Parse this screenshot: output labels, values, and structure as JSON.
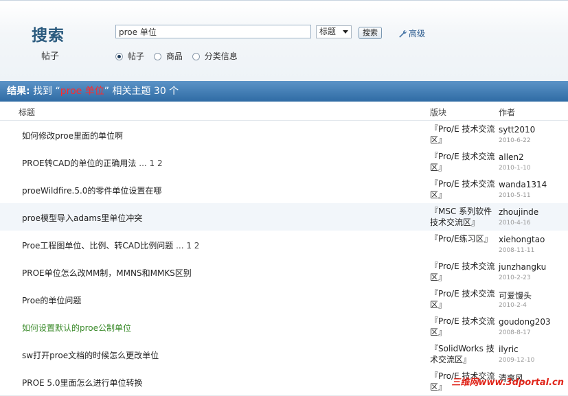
{
  "search": {
    "title": "搜索",
    "subtitle": "帖子",
    "query": "proe 单位",
    "scope_selected": "标题",
    "submit_label": "搜索",
    "advanced_label": "高级",
    "types": [
      "帖子",
      "商品",
      "分类信息"
    ],
    "type_selected": "帖子"
  },
  "results": {
    "prefix": "结果:",
    "found": "找到",
    "keyword_open": "“",
    "keyword": "proe 单位",
    "keyword_close": "”",
    "suffix": "相关主题",
    "count": "30 个"
  },
  "table": {
    "headers": {
      "title": "标题",
      "forum": "版块",
      "author": "作者"
    },
    "rows": [
      {
        "title": "如何修改proe里面的单位啊",
        "pages": "",
        "forum": "『Pro/E 技术交流区』",
        "author": "sytt2010",
        "date": "2010-6-22"
      },
      {
        "title": "PROE转CAD的单位的正确用法",
        "pages": "... 1 2",
        "forum": "『Pro/E 技术交流区』",
        "author": "allen2",
        "date": "2010-1-10"
      },
      {
        "title": "proeWildfire.5.0的零件单位设置在哪",
        "pages": "",
        "forum": "『Pro/E 技术交流区』",
        "author": "wanda1314",
        "date": "2010-5-11"
      },
      {
        "title": "proe模型导入adams里单位冲突",
        "pages": "",
        "forum": "『MSC 系列软件技术交流区』",
        "author": "zhoujinde",
        "date": "2010-4-16"
      },
      {
        "title": "Proe工程图单位、比例、转CAD比例问题",
        "pages": "... 1 2",
        "forum": "『Pro/E练习区』",
        "author": "xiehongtao",
        "date": "2008-11-11"
      },
      {
        "title": "PROE单位怎么改MM制，MMNS和MMKS区别",
        "pages": "",
        "forum": "『Pro/E 技术交流区』",
        "author": "junzhangku",
        "date": "2010-2-23"
      },
      {
        "title": "Proe的单位问题",
        "pages": "",
        "forum": "『Pro/E 技术交流区』",
        "author": "可爱馒头",
        "date": "2010-2-4"
      },
      {
        "title": "如何设置默认的proe公制单位",
        "pages": "",
        "forum": "『Pro/E 技术交流区』",
        "author": "goudong203",
        "date": "2008-8-17"
      },
      {
        "title": "sw打开proe文档的时候怎么更改单位",
        "pages": "",
        "forum": "『SolidWorks 技术交流区』",
        "author": "ilyric",
        "date": "2009-12-10"
      },
      {
        "title": "PROE 5.0里面怎么进行单位转换",
        "pages": "",
        "forum": "『Pro/E 技术交流区』",
        "author": "清爽风",
        "date": ""
      }
    ]
  },
  "watermark": "三维网www.3dportal.cn",
  "colors": {
    "accent": "#2f6ba4",
    "keyword": "#ff2a2a",
    "visited_link": "#3a8a2a"
  }
}
